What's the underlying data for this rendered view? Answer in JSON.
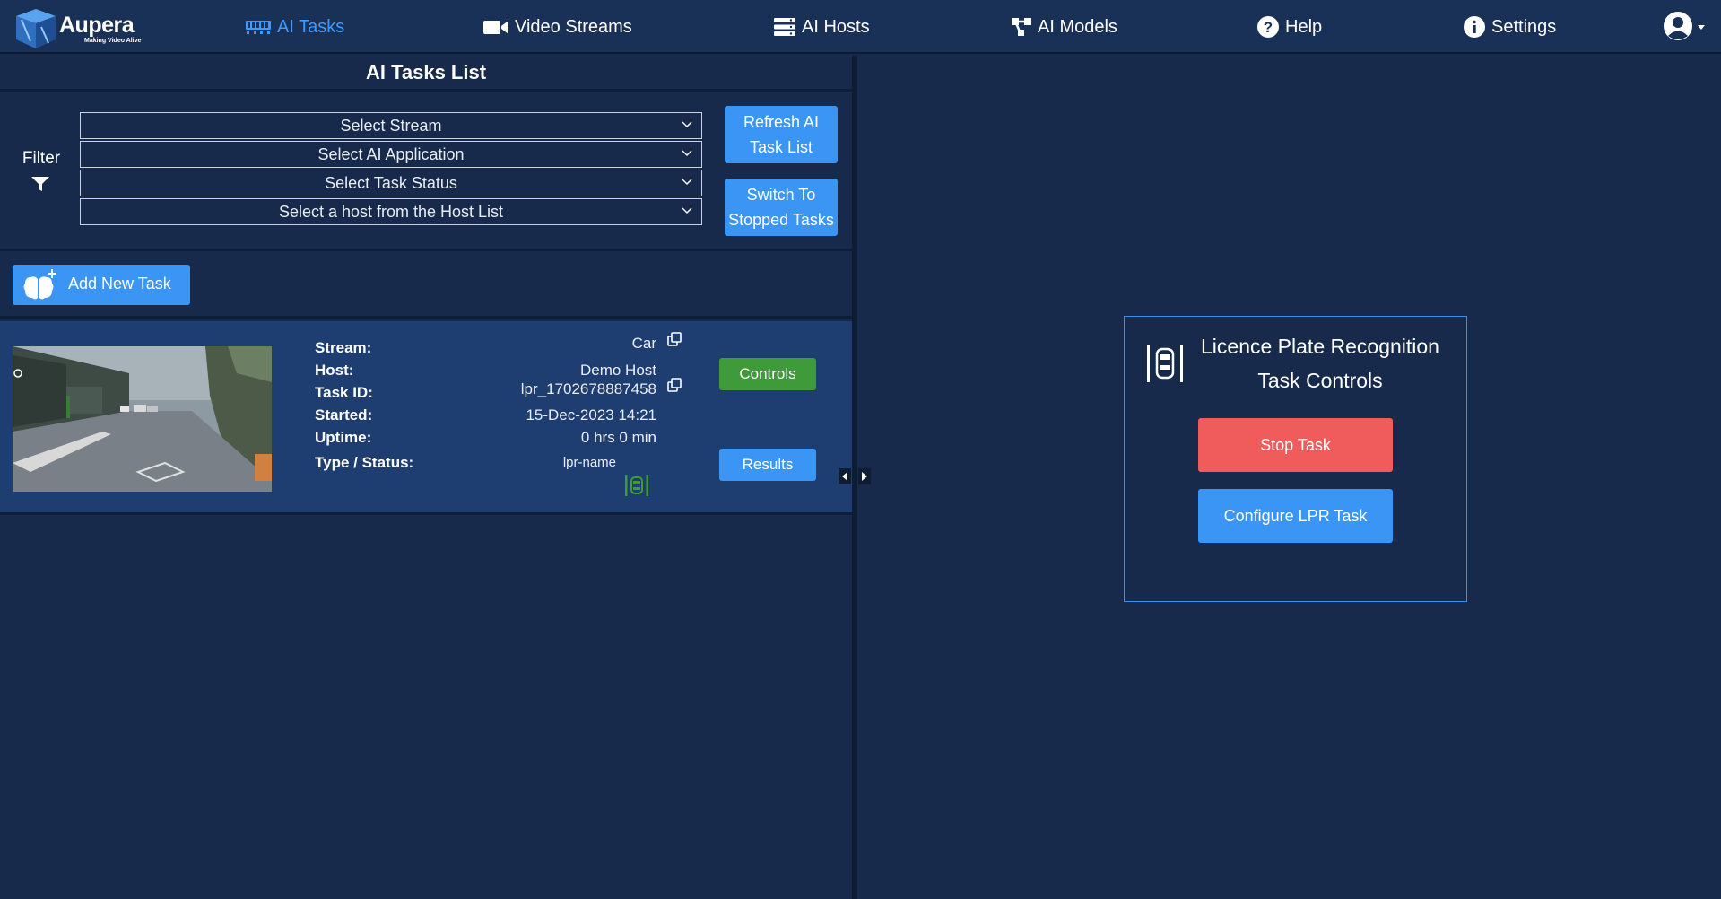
{
  "brand": {
    "name": "Aupera",
    "tagline": "Making Video Alive"
  },
  "nav": {
    "items": [
      {
        "label": "AI Tasks",
        "icon": "ai-tasks-icon",
        "active": true
      },
      {
        "label": "Video Streams",
        "icon": "video-camera-icon",
        "active": false
      },
      {
        "label": "AI Hosts",
        "icon": "server-icon",
        "active": false
      },
      {
        "label": "AI Models",
        "icon": "network-icon",
        "active": false
      },
      {
        "label": "Help",
        "icon": "question-circle-icon",
        "active": false
      },
      {
        "label": "Settings",
        "icon": "info-circle-icon",
        "active": false
      }
    ],
    "user_icon": "user-circle-icon"
  },
  "tasks_panel": {
    "title": "AI Tasks List",
    "filter": {
      "label": "Filter",
      "selects": [
        {
          "placeholder": "Select Stream"
        },
        {
          "placeholder": "Select AI Application"
        },
        {
          "placeholder": "Select Task Status"
        },
        {
          "placeholder": "Select a host from the Host List"
        }
      ],
      "refresh_button": "Refresh AI Task List",
      "switch_button": "Switch To Stopped Tasks"
    },
    "add_task_button": "Add New Task",
    "tasks": [
      {
        "stream_label": "Stream:",
        "stream": "Car",
        "host_label": "Host:",
        "host": "Demo Host",
        "task_id_label": "Task ID:",
        "task_id": "lpr_1702678887458",
        "started_label": "Started:",
        "started": "15-Dec-2023 14:21",
        "uptime_label": "Uptime:",
        "uptime": "0 hrs 0 min",
        "type_status_label": "Type / Status:",
        "type": "lpr-name",
        "status_color": "#3f9b3a",
        "controls_button": "Controls",
        "results_button": "Results"
      }
    ]
  },
  "controls_card": {
    "title_line1": "Licence Plate Recognition",
    "title_line2": "Task Controls",
    "stop_button": "Stop Task",
    "configure_button": "Configure LPR Task"
  },
  "colors": {
    "background": "#172a4b",
    "navbar": "#1a3157",
    "accent_blue": "#3b95f5",
    "green": "#3f9b3a",
    "red": "#f05c5c",
    "active_nav": "#3d9bff"
  }
}
